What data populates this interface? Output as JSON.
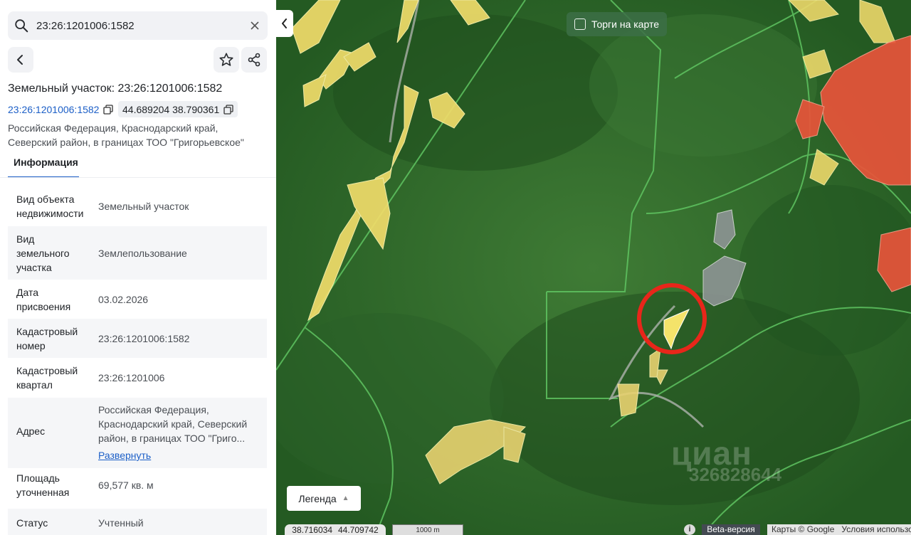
{
  "search": {
    "value": "23:26:1201006:1582"
  },
  "header": {
    "title": "Земельный участок: 23:26:1201006:1582"
  },
  "chips": {
    "cadastral": "23:26:1201006:1582",
    "coords": "44.689204 38.790361"
  },
  "address_lines": [
    "Российская Федерация, Краснодарский край,",
    "Северский район, в границах ТОО \"Григорьевское\""
  ],
  "tabs": {
    "info": "Информация"
  },
  "info_rows": [
    {
      "key_lines": [
        "Вид объекта",
        "недвижимости"
      ],
      "value_lines": [
        "Земельный участок"
      ]
    },
    {
      "key_lines": [
        "Вид",
        "земельного",
        "участка"
      ],
      "value_lines": [
        "Землепользование"
      ]
    },
    {
      "key_lines": [
        "Дата",
        "присвоения"
      ],
      "value_lines": [
        "03.02.2026"
      ]
    },
    {
      "key_lines": [
        "Кадастровый",
        "номер"
      ],
      "value_lines": [
        "23:26:1201006:1582"
      ]
    },
    {
      "key_lines": [
        "Кадастровый",
        "квартал"
      ],
      "value_lines": [
        "23:26:1201006"
      ]
    },
    {
      "key_lines": [
        "Адрес"
      ],
      "value_lines": [
        "Российская Федерация,",
        "Краснодарский край, Северский",
        "район, в границах ТОО \"Григо..."
      ],
      "link": "Развернуть"
    },
    {
      "key_lines": [
        "Площадь",
        "уточненная"
      ],
      "value_lines": [
        "69,577 кв. м"
      ]
    },
    {
      "key_lines": [
        "Статус"
      ],
      "value_lines": [
        "Учтенный"
      ]
    }
  ],
  "map": {
    "torgi_label": "Торги на карте",
    "legend_label": "Легенда",
    "cursor_coords": [
      "38.716034",
      "44.709742"
    ],
    "scale_label": "1000 m",
    "info_icon": "i",
    "beta_label": "Beta-версия",
    "attribution": "Карты © Google",
    "terms": "Условия использования",
    "watermark_logo": "циан",
    "watermark_id": "326828644"
  },
  "colors": {
    "accent": "#1c5fc7",
    "highlight": "#e8261a",
    "parcel_yellow": "#f2e26b",
    "parcel_red": "#e8543a"
  }
}
